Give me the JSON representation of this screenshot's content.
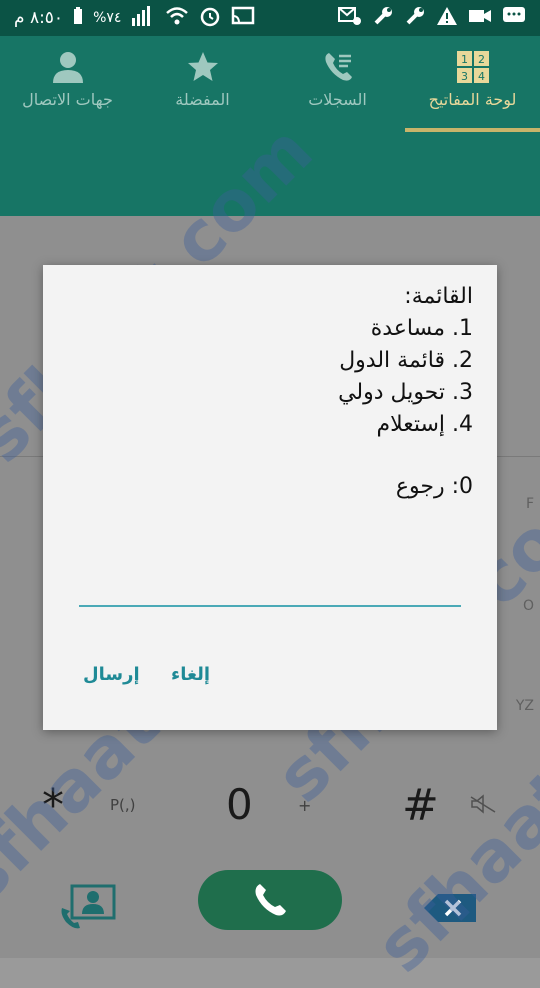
{
  "status_bar": {
    "time": "٨:٥٠ م",
    "battery": "%٧٤"
  },
  "tabs": [
    {
      "label": "لوحة المفاتيح",
      "icon": "dialpad-icon",
      "active": true
    },
    {
      "label": "السجلات",
      "icon": "call-log-icon",
      "active": false
    },
    {
      "label": "المفضلة",
      "icon": "star-icon",
      "active": false
    },
    {
      "label": "جهات الاتصال",
      "icon": "contacts-icon",
      "active": false
    }
  ],
  "dialog": {
    "menu_title": "القائمة:",
    "items": [
      "1. مساعدة",
      "2. قائمة الدول",
      "3. تحويل دولي",
      "4. إستعلام"
    ],
    "back": "0: رجوع",
    "reply_placeholder": "",
    "cancel_label": "إلغاء",
    "send_label": "إرسال"
  },
  "keypad": {
    "star": "*",
    "star_sub": "P(,)",
    "zero": "0",
    "zero_sub": "+",
    "hash": "#",
    "side_letters": [
      "F",
      "O",
      "YZ"
    ]
  },
  "watermark": "sfhaat.com"
}
